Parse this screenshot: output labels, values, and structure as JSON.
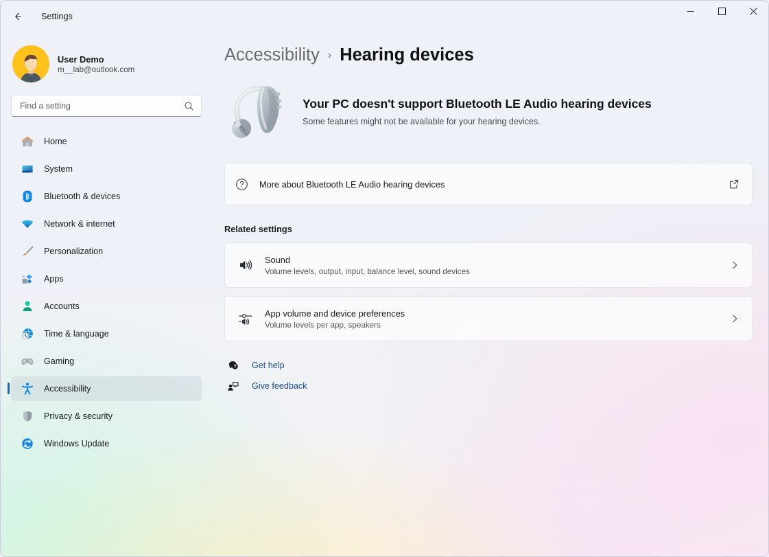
{
  "window": {
    "titlebar_title": "Settings",
    "back_tooltip": "Back",
    "minimize_label": "Minimize",
    "maximize_label": "Maximize",
    "close_label": "Close"
  },
  "account": {
    "name": "User Demo",
    "email": "m__lab@outlook.com"
  },
  "search": {
    "placeholder": "Find a setting",
    "value": ""
  },
  "sidebar": {
    "items": [
      {
        "label": "Home",
        "icon": "home-icon",
        "selected": false
      },
      {
        "label": "System",
        "icon": "system-icon",
        "selected": false
      },
      {
        "label": "Bluetooth & devices",
        "icon": "bluetooth-icon",
        "selected": false
      },
      {
        "label": "Network & internet",
        "icon": "wifi-icon",
        "selected": false
      },
      {
        "label": "Personalization",
        "icon": "brush-icon",
        "selected": false
      },
      {
        "label": "Apps",
        "icon": "apps-icon",
        "selected": false
      },
      {
        "label": "Accounts",
        "icon": "person-icon",
        "selected": false
      },
      {
        "label": "Time & language",
        "icon": "clock-globe-icon",
        "selected": false
      },
      {
        "label": "Gaming",
        "icon": "gamepad-icon",
        "selected": false
      },
      {
        "label": "Accessibility",
        "icon": "accessibility-icon",
        "selected": true
      },
      {
        "label": "Privacy & security",
        "icon": "shield-icon",
        "selected": false
      },
      {
        "label": "Windows Update",
        "icon": "update-icon",
        "selected": false
      }
    ]
  },
  "breadcrumb": {
    "parent": "Accessibility",
    "separator": "›",
    "current": "Hearing devices"
  },
  "hero": {
    "image": "hearing-aid-illustration",
    "title": "Your PC doesn't support Bluetooth LE Audio hearing devices",
    "subtitle": "Some features might not be available for your hearing devices."
  },
  "learn_more_card": {
    "icon": "help-circle-icon",
    "label": "More about Bluetooth LE Audio hearing devices",
    "trailing_icon": "open-external-icon"
  },
  "related": {
    "section_title": "Related settings",
    "rows": [
      {
        "title": "Sound",
        "subtitle": "Volume levels, output, input, balance level, sound devices",
        "icon": "speaker-icon",
        "chevron": "chevron-right-icon"
      },
      {
        "title": "App volume and device preferences",
        "subtitle": "Volume levels per app, speakers",
        "icon": "app-volume-icon",
        "chevron": "chevron-right-icon"
      }
    ]
  },
  "footer_links": [
    {
      "label": "Get help",
      "icon": "get-help-icon"
    },
    {
      "label": "Give feedback",
      "icon": "give-feedback-icon"
    }
  ],
  "colors": {
    "accent": "#0f6cbd",
    "link": "#1a4d8f",
    "bluetooth": "#0f86e8",
    "accessibility": "#1186e0",
    "avatar_bg": "#ffc21c",
    "window_bg": "#eef1f7"
  }
}
